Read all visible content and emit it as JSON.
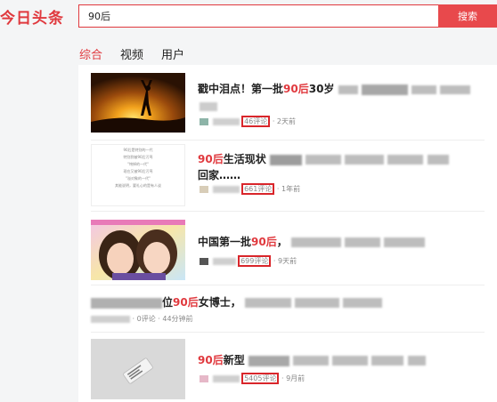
{
  "header": {
    "logo": "今日头条",
    "search_value": "90后",
    "search_button": "搜索"
  },
  "tabs": [
    {
      "label": "综合",
      "active": true
    },
    {
      "label": "视频",
      "active": false
    },
    {
      "label": "用户",
      "active": false
    }
  ],
  "results": [
    {
      "title_pre": "戳中泪点！第一批",
      "title_hl": "90后",
      "title_post": "30岁",
      "comments": "46评论",
      "time": "2天前"
    },
    {
      "title_pre": "",
      "title_hl": "90后",
      "title_post": "生活现状",
      "title_line2": "回家……",
      "comments": "661评论",
      "time": "1年前",
      "thumb_lines": [
        "90后是特别的一代",
        "特别到被90后污骂",
        "\"垮掉的一代\"",
        "现在又被90后污骂",
        "\"溢对象的一代\"",
        "",
        "其能说明，要礼心的是有人谈"
      ]
    },
    {
      "title_pre": "中国第一批",
      "title_hl": "90后",
      "title_post": "，",
      "comments": "699评论",
      "time": "9天前"
    },
    {
      "title_pre": "位",
      "title_hl": "90后",
      "title_post": "女博士，",
      "comments": "0评论",
      "time": "44分钟前"
    },
    {
      "title_pre": "",
      "title_hl": "90后",
      "title_post": "新型",
      "comments": "5405评论",
      "time": "9月前"
    }
  ]
}
